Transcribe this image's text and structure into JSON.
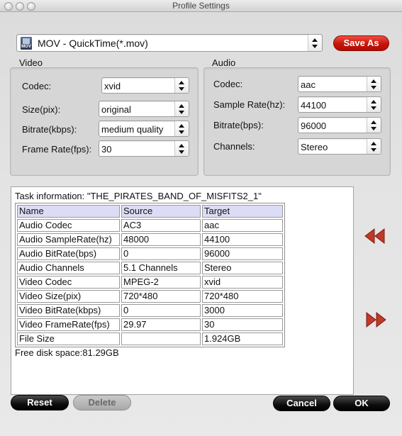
{
  "window": {
    "title": "Profile Settings"
  },
  "profile": {
    "icon": "mov-file-icon",
    "icon_text": "MOV",
    "value": "MOV - QuickTime(*.mov)"
  },
  "buttons": {
    "save_as": "Save As",
    "reset": "Reset",
    "delete": "Delete",
    "cancel": "Cancel",
    "ok": "OK"
  },
  "video": {
    "title": "Video",
    "codec": {
      "label": "Codec:",
      "value": "xvid"
    },
    "size": {
      "label": "Size(pix):",
      "value": "original"
    },
    "bitrate": {
      "label": "Bitrate(kbps):",
      "value": "medium quality"
    },
    "framerate": {
      "label": "Frame Rate(fps):",
      "value": "30"
    }
  },
  "audio": {
    "title": "Audio",
    "codec": {
      "label": "Codec:",
      "value": "aac"
    },
    "samplerate": {
      "label": "Sample Rate(hz):",
      "value": "44100"
    },
    "bitrate": {
      "label": "Bitrate(bps):",
      "value": "96000"
    },
    "channels": {
      "label": "Channels:",
      "value": "Stereo"
    }
  },
  "task": {
    "info_label": "Task information: \"THE_PIRATES_BAND_OF_MISFITS2_1\"",
    "headers": [
      "Name",
      "Source",
      "Target"
    ],
    "rows": [
      [
        "Audio Codec",
        "AC3",
        "aac"
      ],
      [
        "Audio SampleRate(hz)",
        "48000",
        "44100"
      ],
      [
        "Audio BitRate(bps)",
        "0",
        "96000"
      ],
      [
        "Audio Channels",
        "5.1 Channels",
        "Stereo"
      ],
      [
        "Video Codec",
        "MPEG-2",
        "xvid"
      ],
      [
        "Video Size(pix)",
        "720*480",
        "720*480"
      ],
      [
        "Video BitRate(kbps)",
        "0",
        "3000"
      ],
      [
        "Video FrameRate(fps)",
        "29.97",
        "30"
      ],
      [
        "File Size",
        "",
        "1.924GB"
      ]
    ],
    "free_disk": "Free disk space:81.29GB"
  },
  "colors": {
    "accent_red": "#c8221a",
    "arrow_red": "#c0392b",
    "header_row": "#dcdcf6"
  },
  "icons": {
    "collapse": "double-chevron-left-icon",
    "expand": "double-chevron-right-icon"
  }
}
